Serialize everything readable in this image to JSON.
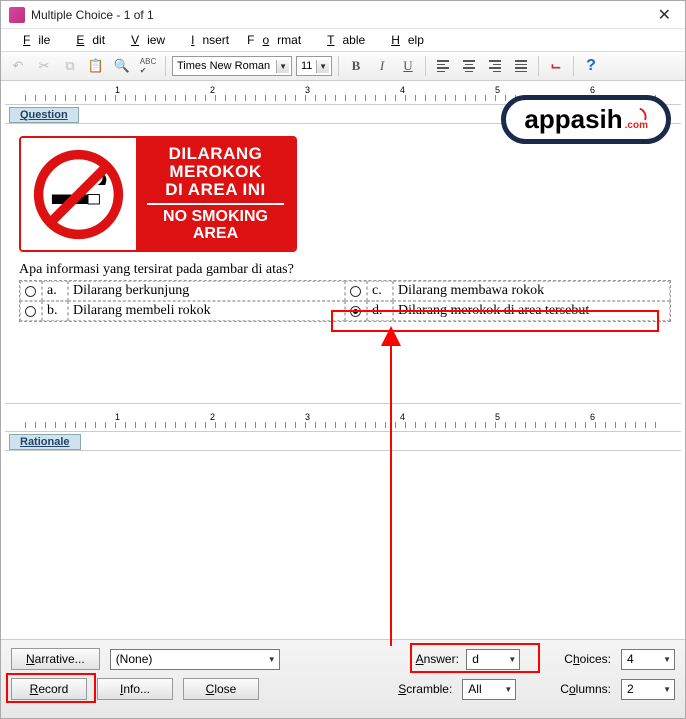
{
  "window": {
    "title": "Multiple Choice - 1 of 1"
  },
  "menu": {
    "file": "File",
    "edit": "Edit",
    "view": "View",
    "insert": "Insert",
    "format": "Format",
    "table": "Table",
    "help": "Help"
  },
  "toolbar": {
    "font": "Times New Roman",
    "size": "11"
  },
  "tabs": {
    "question": "Question",
    "rationale": "Rationale"
  },
  "sign": {
    "line1": "DILARANG",
    "line2": "MEROKOK",
    "line3": "DI AREA INI",
    "line4": "NO SMOKING",
    "line5": "AREA"
  },
  "prompt": "Apa informasi yang tersirat pada gambar di atas?",
  "choices": {
    "a": {
      "letter": "a.",
      "text": "Dilarang berkunjung"
    },
    "b": {
      "letter": "b.",
      "text": "Dilarang membeli rokok"
    },
    "c": {
      "letter": "c.",
      "text": "Dilarang membawa rokok"
    },
    "d": {
      "letter": "d.",
      "text": "Dilarang merokok di area tersebut"
    }
  },
  "ruler": {
    "r1": "1",
    "r2": "2",
    "r3": "3",
    "r4": "4",
    "r5": "5",
    "r6": "6"
  },
  "footer": {
    "narrative": "Narrative...",
    "narrative_val": "(None)",
    "record": "Record",
    "info": "Info...",
    "close": "Close",
    "answer_lbl": "Answer:",
    "answer_val": "d",
    "scramble_lbl": "Scramble:",
    "scramble_val": "All",
    "choices_lbl": "Choices:",
    "choices_val": "4",
    "columns_lbl": "Columns:",
    "columns_val": "2"
  },
  "badge": {
    "text": "appasih",
    "sub": ".com"
  }
}
